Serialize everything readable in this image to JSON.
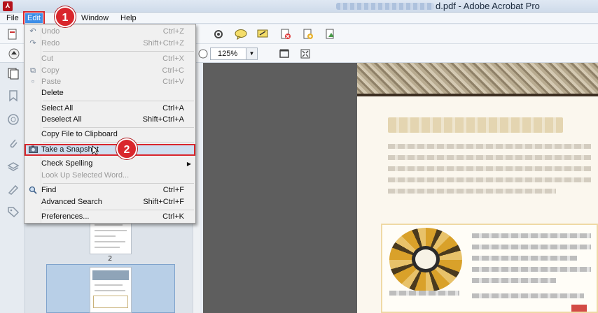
{
  "window": {
    "title": "d.pdf - Adobe Acrobat Pro"
  },
  "menubar": {
    "items": [
      "File",
      "Edit",
      "Window",
      "Help"
    ],
    "active": "Edit"
  },
  "toolbar": {
    "zoom_value": "125%"
  },
  "thumbnails": {
    "page_label": "2"
  },
  "edit_menu": {
    "items": [
      {
        "label": "Undo",
        "shortcut": "Ctrl+Z",
        "disabled": true,
        "icon": "undo-icon"
      },
      {
        "label": "Redo",
        "shortcut": "Shift+Ctrl+Z",
        "disabled": true,
        "icon": "redo-icon"
      },
      {
        "label": "Cut",
        "shortcut": "Ctrl+X",
        "disabled": true,
        "icon": ""
      },
      {
        "label": "Copy",
        "shortcut": "Ctrl+C",
        "disabled": true,
        "icon": "copy-icon"
      },
      {
        "label": "Paste",
        "shortcut": "Ctrl+V",
        "disabled": true,
        "icon": "paste-icon"
      },
      {
        "label": "Delete",
        "shortcut": "",
        "disabled": false,
        "icon": ""
      },
      {
        "label": "Select All",
        "shortcut": "Ctrl+A",
        "disabled": false,
        "icon": ""
      },
      {
        "label": "Deselect All",
        "shortcut": "Shift+Ctrl+A",
        "disabled": false,
        "icon": ""
      },
      {
        "label": "Copy File to Clipboard",
        "shortcut": "",
        "disabled": false,
        "icon": ""
      },
      {
        "label": "Take a Snapshot",
        "shortcut": "",
        "disabled": false,
        "icon": "camera-icon",
        "highlighted": true
      },
      {
        "label": "Check Spelling",
        "shortcut": "",
        "disabled": false,
        "icon": "",
        "submenu": true
      },
      {
        "label": "Look Up Selected Word...",
        "shortcut": "",
        "disabled": true,
        "icon": ""
      },
      {
        "label": "Find",
        "shortcut": "Ctrl+F",
        "disabled": false,
        "icon": "search-icon"
      },
      {
        "label": "Advanced Search",
        "shortcut": "Shift+Ctrl+F",
        "disabled": false,
        "icon": ""
      },
      {
        "label": "Preferences...",
        "shortcut": "Ctrl+K",
        "disabled": false,
        "icon": ""
      }
    ]
  },
  "badges": {
    "step1": "1",
    "step2": "2"
  },
  "colors": {
    "accent": "#d9262c",
    "menu_active": "#3d8ee8",
    "highlight_row": "#cfdff0"
  }
}
